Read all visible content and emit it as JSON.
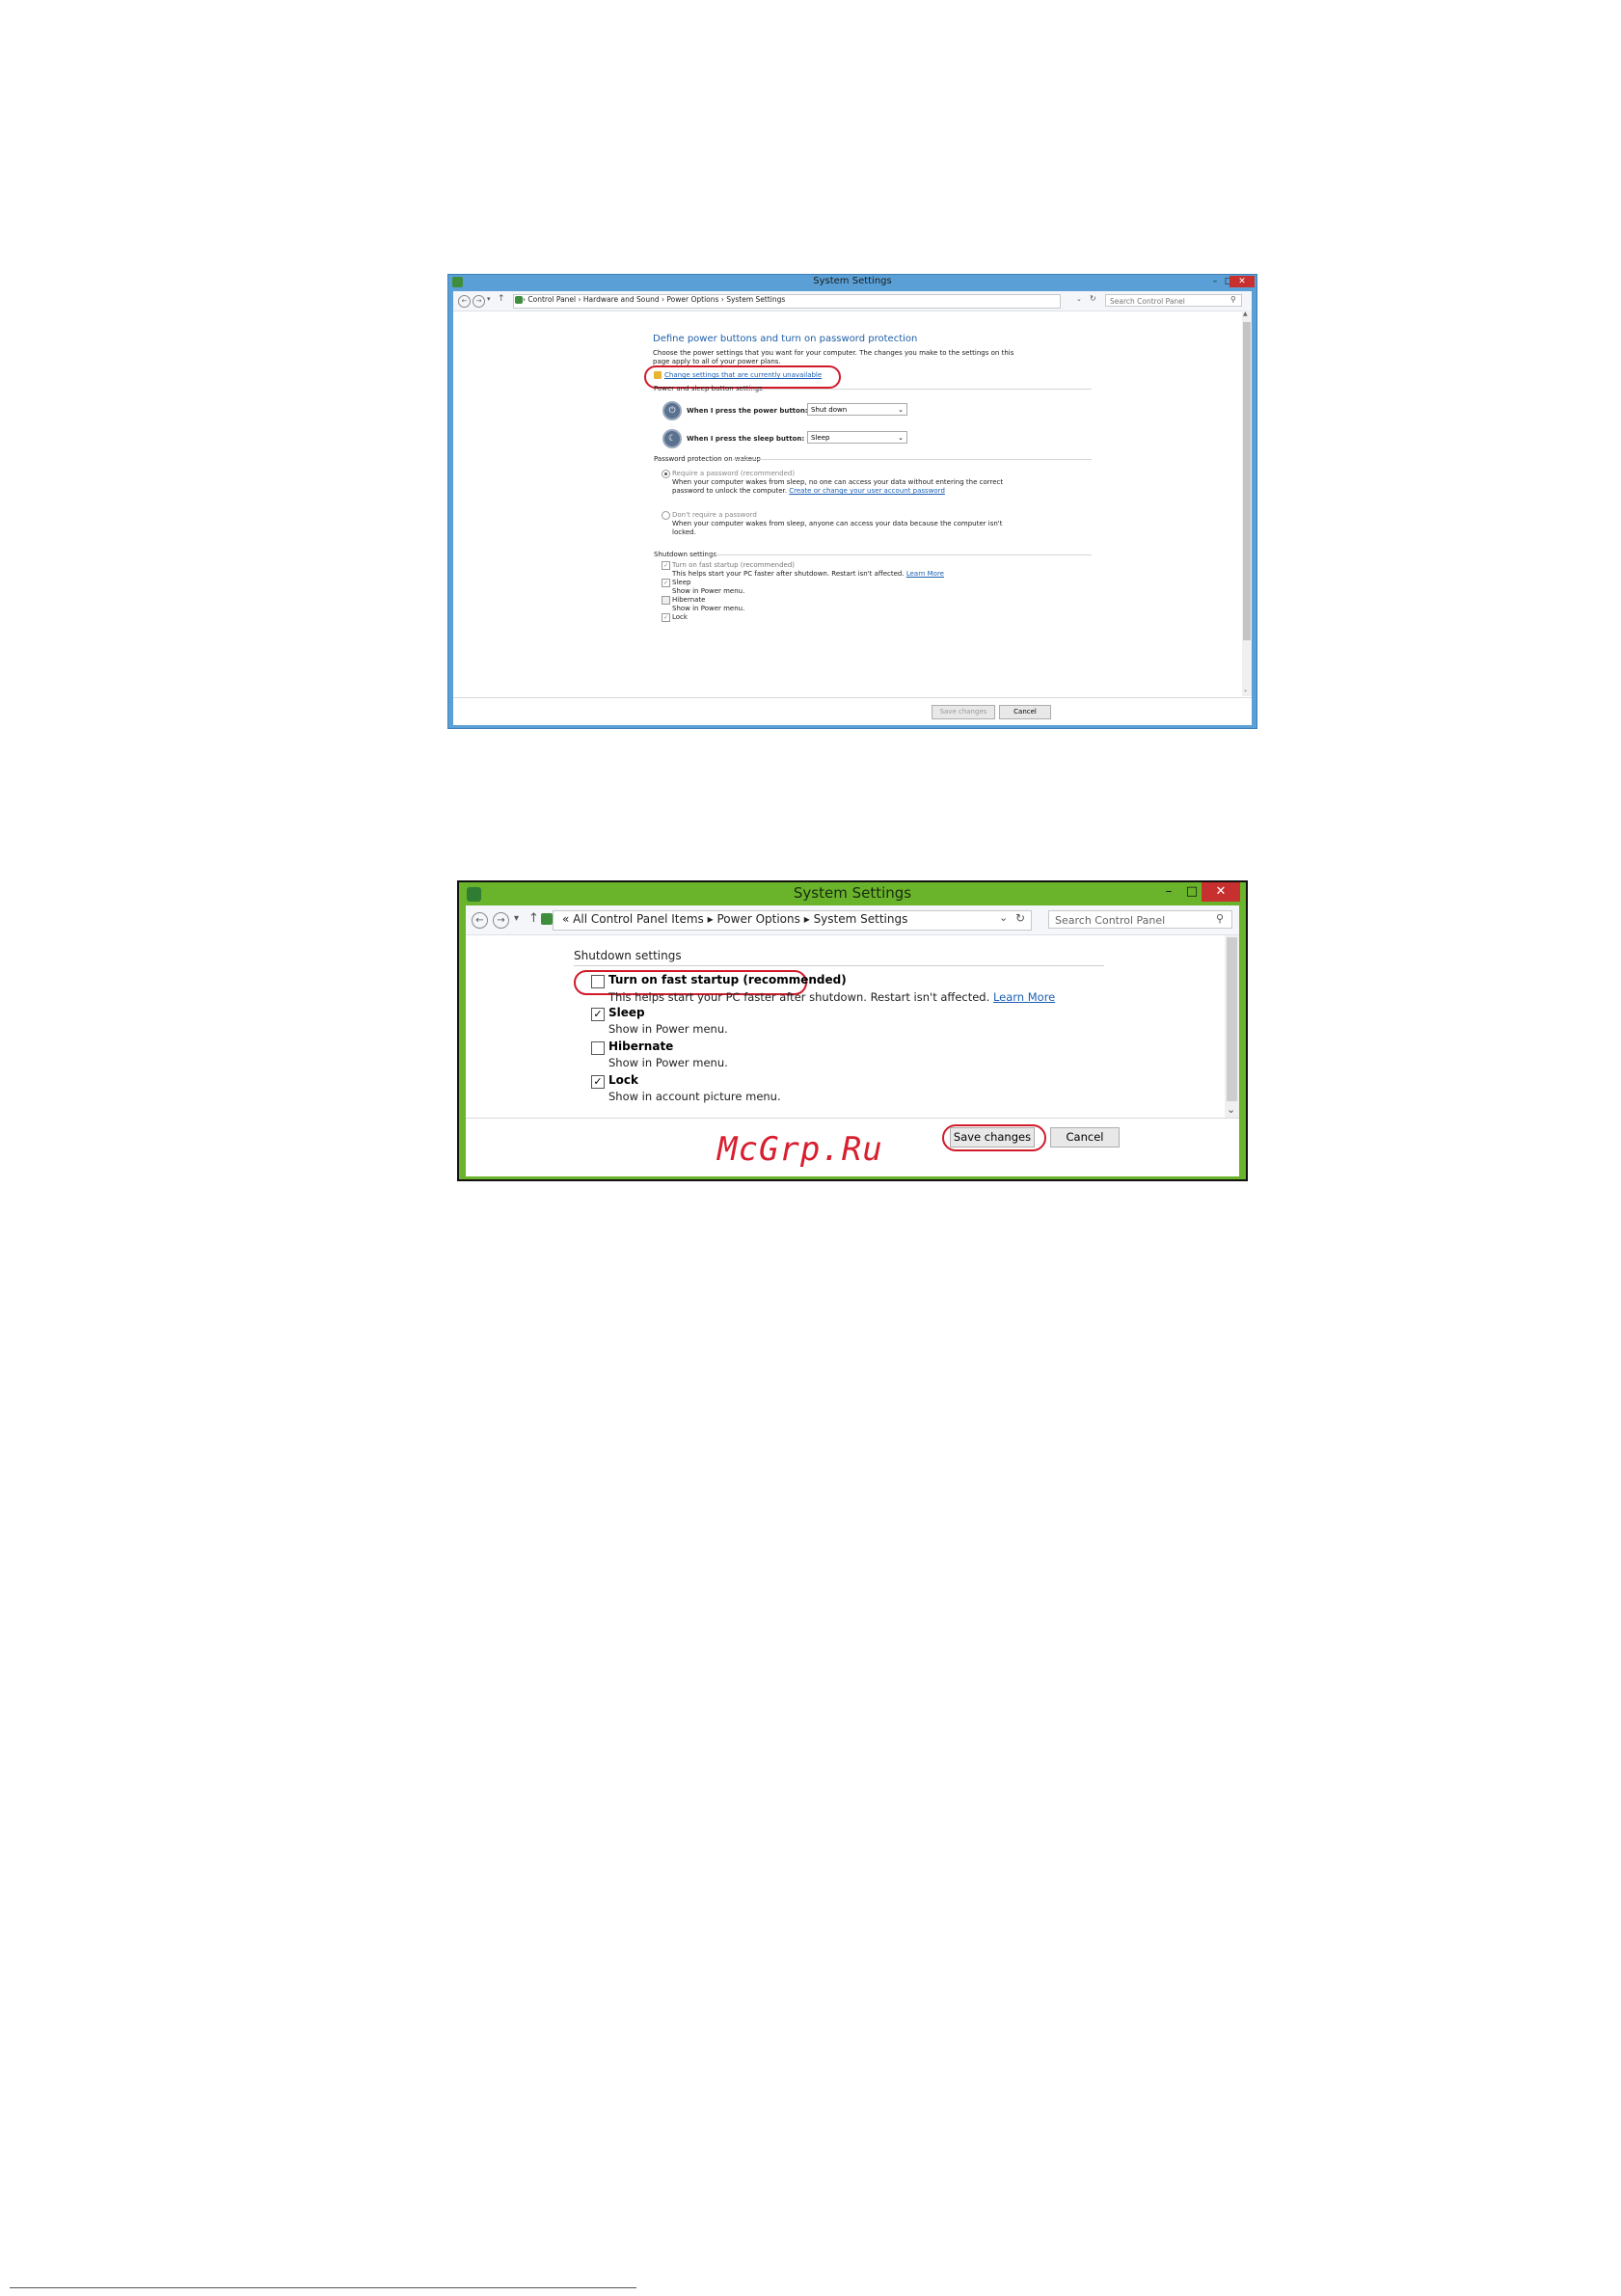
{
  "window1": {
    "title": "System Settings",
    "address": {
      "breadcrumb_items": [
        "Control Panel",
        "Hardware and Sound",
        "Power Options",
        "System Settings"
      ],
      "search_placeholder": "Search Control Panel"
    },
    "heading": "Define power buttons and turn on password protection",
    "intro_line1": "Choose the power settings that you want for your computer. The changes you make to the settings on this",
    "intro_line2": "page apply to all of your power plans.",
    "change_settings_link": "Change settings that are currently unavailable",
    "power_section": {
      "title": "Power and sleep button settings",
      "power_button_label": "When I press the power button:",
      "power_button_value": "Shut down",
      "sleep_button_label": "When I press the sleep button:",
      "sleep_button_value": "Sleep"
    },
    "password_section": {
      "title": "Password protection on wakeup",
      "require_label": "Require a password (recommended)",
      "require_desc1": "When your computer wakes from sleep, no one can access your data without entering the correct",
      "require_desc2": "password to unlock the computer.",
      "require_link": "Create or change your user account password",
      "dont_require_label": "Don't require a password",
      "dont_require_desc1": "When your computer wakes from sleep, anyone can access your data because the computer isn't",
      "dont_require_desc2": "locked."
    },
    "shutdown_section": {
      "title": "Shutdown settings",
      "fast_startup_label": "Turn on fast startup (recommended)",
      "fast_startup_desc": "This helps start your PC faster after shutdown. Restart isn't affected.",
      "learn_more": "Learn More",
      "sleep_label": "Sleep",
      "sleep_desc": "Show in Power menu.",
      "hibernate_label": "Hibernate",
      "hibernate_desc": "Show in Power menu.",
      "lock_label": "Lock"
    },
    "buttons": {
      "save": "Save changes",
      "cancel": "Cancel"
    }
  },
  "window2": {
    "title": "System Settings",
    "address": {
      "breadcrumb_prefix": "«",
      "breadcrumb_items": [
        "All Control Panel Items",
        "Power Options",
        "System Settings"
      ],
      "search_placeholder": "Search Control Panel"
    },
    "shutdown_section": {
      "title": "Shutdown settings",
      "fast_startup_label": "Turn on fast startup (recommended)",
      "fast_startup_desc": "This helps start your PC faster after shutdown. Restart isn't affected.",
      "learn_more": "Learn More",
      "sleep_label": "Sleep",
      "sleep_desc": "Show in Power menu.",
      "hibernate_label": "Hibernate",
      "hibernate_desc": "Show in Power menu.",
      "lock_label": "Lock",
      "lock_desc": "Show in account picture menu."
    },
    "buttons": {
      "save": "Save changes",
      "cancel": "Cancel"
    }
  },
  "watermark": "McGrp.Ru",
  "accent_colors": {
    "win1_frame": "#5aa0d6",
    "win2_frame": "#6ab42b",
    "highlight": "#d11a2a"
  }
}
